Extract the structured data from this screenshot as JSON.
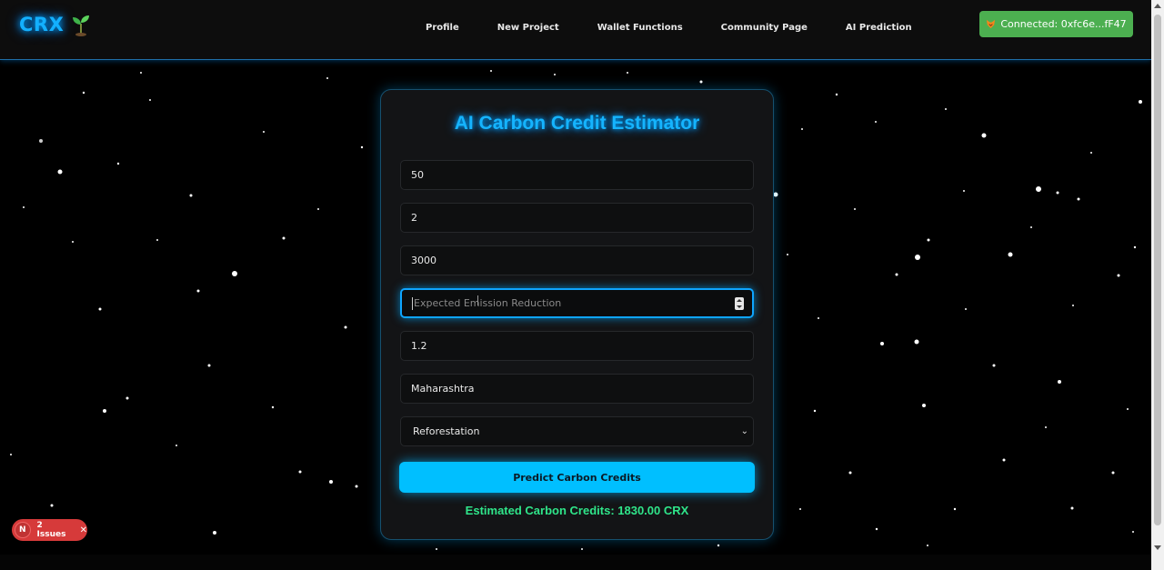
{
  "brand": {
    "logo_text": "CRX",
    "logo_icon": "sprout-icon"
  },
  "nav": {
    "links": [
      "Profile",
      "New Project",
      "Wallet Functions",
      "Community Page",
      "AI Prediction"
    ]
  },
  "wallet": {
    "status_text": "Connected: 0xfc6e...fF47",
    "icon": "fox-icon",
    "color": "#4caf50"
  },
  "form": {
    "title": "AI Carbon Credit Estimator",
    "fields": [
      {
        "value": "50"
      },
      {
        "value": "2"
      },
      {
        "value": "3000"
      },
      {
        "value": "",
        "placeholder": "Expected Emission Reduction"
      },
      {
        "value": "1.2"
      },
      {
        "value": "Maharashtra"
      }
    ],
    "project_type": {
      "selected": "Reforestation"
    },
    "submit_label": "Predict Carbon Credits",
    "result_text": "Estimated Carbon Credits: 1830.00 CRX"
  },
  "issues_badge": {
    "icon_letter": "N",
    "label": "2 Issues",
    "close": "✕"
  },
  "colors": {
    "accent": "#00bfff",
    "result": "#2fe58a",
    "badge": "#d63a3a"
  }
}
